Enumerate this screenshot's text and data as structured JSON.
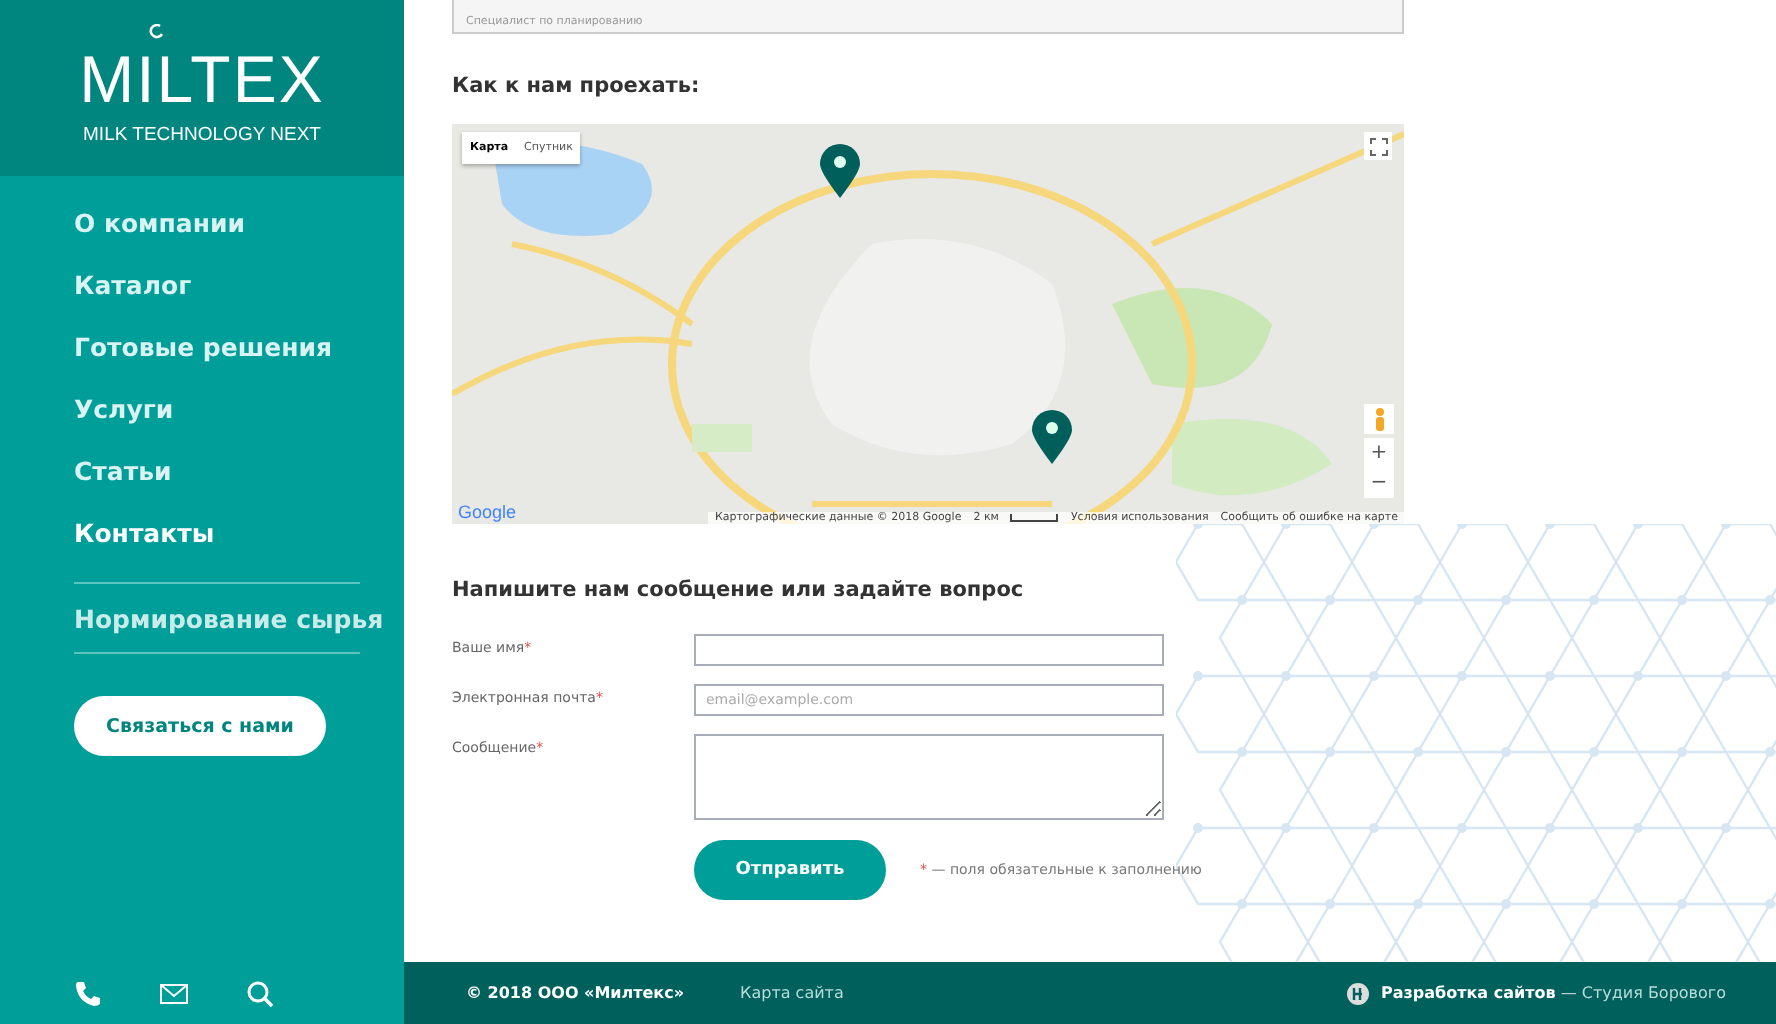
{
  "logo": {
    "name": "MILTEX",
    "tagline": "MILK TECHNOLOGY NEXT"
  },
  "nav": [
    {
      "label": "О компании",
      "selected": false
    },
    {
      "label": "Каталог",
      "selected": false
    },
    {
      "label": "Готовые решения",
      "selected": false
    },
    {
      "label": "Услуги",
      "selected": false
    },
    {
      "label": "Статьи",
      "selected": false
    },
    {
      "label": "Контакты",
      "selected": true
    }
  ],
  "nav_extra": {
    "label": "Нормирование сырья"
  },
  "contact_button": "Связаться с нами",
  "top_card": {
    "text": "Специалист по планированию"
  },
  "map_section": {
    "heading": "Как к нам проехать:",
    "map_types": [
      {
        "label": "Карта",
        "selected": true
      },
      {
        "label": "Спутник",
        "selected": false
      }
    ],
    "zoom_in": "+",
    "zoom_out": "−",
    "logo": "Google",
    "attribution": "Картографические данные © 2018 Google",
    "scale": "2 км",
    "terms": "Условия использования",
    "report": "Сообщить об ошибке на карте"
  },
  "form": {
    "heading": "Напишите нам сообщение или задайте вопрос",
    "fields": [
      {
        "kind": "text",
        "label": "Ваше имя",
        "required": true
      },
      {
        "kind": "text",
        "label": "Электронная почта",
        "required": true,
        "placeholder": "email@example.com"
      },
      {
        "kind": "textarea",
        "label": "Сообщение",
        "required": true
      }
    ],
    "submit": "Отправить",
    "note_mark": "*",
    "note": "— поля обязательные к заполнению"
  },
  "footer": {
    "copyright": "© 2018 ООО «Милтекс»",
    "sitemap": "Карта сайта",
    "dev_bold": "Разработка сайтов",
    "dev_rest": "— Студия Борового"
  }
}
